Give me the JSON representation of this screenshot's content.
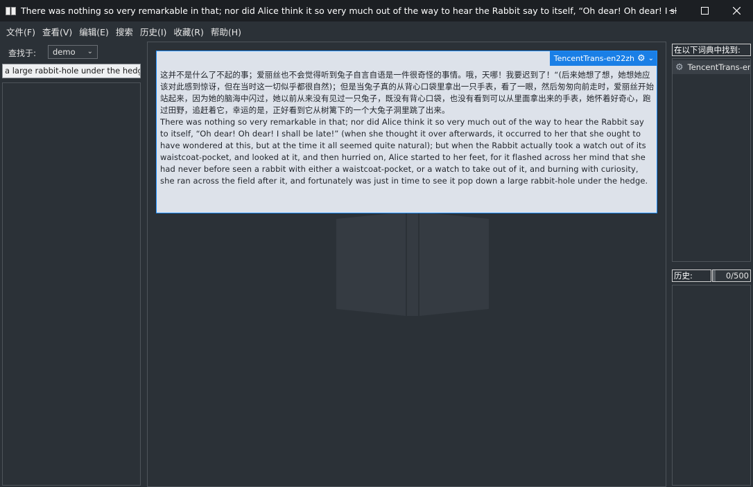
{
  "window": {
    "title": "There was nothing so very remarkable in that; nor did Alice think it so very much out of the way to hear the Rabbit say to itself, “Oh dear! Oh dear! I shall b...",
    "minimize_icon": "minimize-icon",
    "maximize_icon": "maximize-icon",
    "close_icon": "close-icon"
  },
  "menu": {
    "items": [
      "文件(F)",
      "查看(V)",
      "编辑(E)",
      "搜索",
      "历史(I)",
      "收藏(R)",
      "帮助(H)"
    ]
  },
  "left": {
    "find_label": "查找于:",
    "dictionary_selected": "demo",
    "search_value": "a large rabbit-hole under the hedge."
  },
  "result": {
    "dict_name": "TencentTrans-en22zh",
    "chinese": "这并不是什么了不起的事；爱丽丝也不会觉得听到兔子自言自语是一件很奇怪的事情。哦，天哪！我要迟到了！“(后来她想了想，她想她应该对此感到惊讶，但在当时这一切似乎都很自然)；但是当兔子真的从背心口袋里拿出一只手表，看了一眼，然后匆匆向前走时，爱丽丝开始站起来，因为她的脑海中闪过，她以前从来没有见过一只兔子，既没有背心口袋，也没有看到可以从里面拿出来的手表，她怀着好奇心，跑过田野，追赶着它，幸运的是，正好看到它从树篱下的一个大兔子洞里跳了出来。",
    "english": "There was nothing so very remarkable in that; nor did Alice think it so very much out of the way to hear the Rabbit say to itself, “Oh dear! Oh dear! I shall be late!” (when she thought it over afterwards, it occurred to her that she ought to have wondered at this, but at the time it all seemed quite natural); but when the Rabbit actually took a watch out of its waistcoat-pocket, and looked at it, and then hurried on, Alice started to her feet, for it flashed across her mind that she had never before seen a rabbit with either a waistcoat-pocket, or a watch to take out of it, and burning with curiosity, she ran across the field after it, and fortunately was just in time to see it pop down a large rabbit-hole under the hedge."
  },
  "right": {
    "found_label": "在以下词典中找到:",
    "found_items": [
      "TencentTrans-en"
    ],
    "history_label": "历史:",
    "history_count": "0/500"
  },
  "colors": {
    "accent": "#1a7fe6",
    "card_bg": "#dde2ea",
    "app_bg": "#2b3137",
    "titlebar_bg": "#1c1f23"
  }
}
